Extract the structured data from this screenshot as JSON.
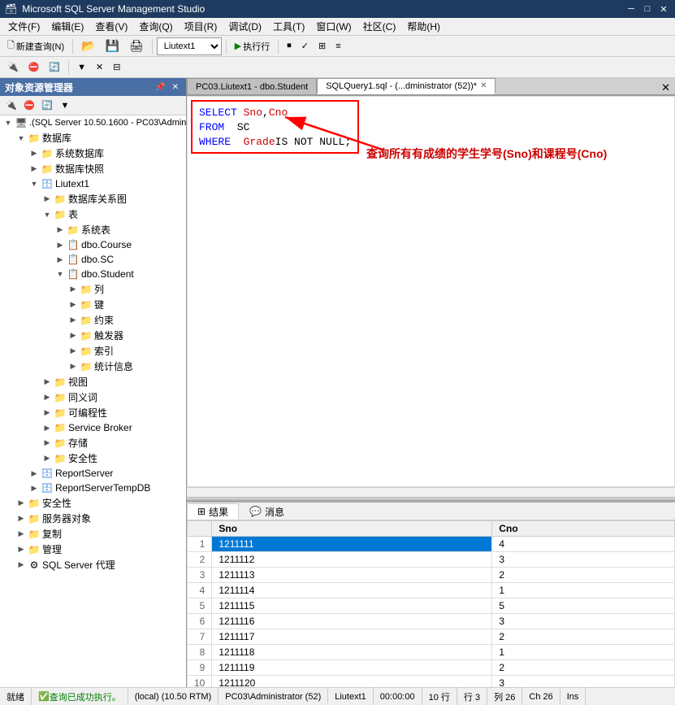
{
  "titleBar": {
    "title": "Microsoft SQL Server Management Studio",
    "icon": "💾",
    "controls": [
      "─",
      "□",
      "✕"
    ]
  },
  "menuBar": {
    "items": [
      "文件(F)",
      "编辑(E)",
      "查看(V)",
      "查询(Q)",
      "项目(R)",
      "调试(D)",
      "工具(T)",
      "窗口(W)",
      "社区(C)",
      "帮助(H)"
    ]
  },
  "toolbar1": {
    "newQuery": "🗋 新建查询(N)",
    "database": "Liutext1",
    "execute": "▶ 执行行"
  },
  "toolbar2": {
    "items": [
      "new",
      "open",
      "save",
      "connect",
      "disconnect",
      "options"
    ]
  },
  "objectExplorer": {
    "title": "对象资源管理器",
    "toolbar": [
      "connect",
      "disconnect",
      "filter",
      "refresh"
    ],
    "tree": [
      {
        "level": 0,
        "expanded": true,
        "icon": "server",
        "label": ".(SQL Server 10.50.1600 - PC03\\Adminis"
      },
      {
        "level": 1,
        "expanded": true,
        "icon": "folder",
        "label": "数据库"
      },
      {
        "level": 2,
        "expanded": true,
        "icon": "folder",
        "label": "系统数据库"
      },
      {
        "level": 2,
        "expanded": false,
        "icon": "folder",
        "label": "数据库快照"
      },
      {
        "level": 2,
        "expanded": true,
        "icon": "db",
        "label": "Liutext1"
      },
      {
        "level": 3,
        "expanded": false,
        "icon": "folder",
        "label": "数据库关系图"
      },
      {
        "level": 3,
        "expanded": true,
        "icon": "folder",
        "label": "表"
      },
      {
        "level": 4,
        "expanded": false,
        "icon": "folder",
        "label": "系统表"
      },
      {
        "level": 4,
        "expanded": false,
        "icon": "table",
        "label": "dbo.Course"
      },
      {
        "level": 4,
        "expanded": false,
        "icon": "table",
        "label": "dbo.SC"
      },
      {
        "level": 4,
        "expanded": true,
        "icon": "table",
        "label": "dbo.Student"
      },
      {
        "level": 5,
        "expanded": false,
        "icon": "folder",
        "label": "列"
      },
      {
        "level": 5,
        "expanded": false,
        "icon": "folder",
        "label": "键"
      },
      {
        "level": 5,
        "expanded": false,
        "icon": "folder",
        "label": "约束"
      },
      {
        "level": 5,
        "expanded": false,
        "icon": "folder",
        "label": "触发器"
      },
      {
        "level": 5,
        "expanded": false,
        "icon": "folder",
        "label": "索引"
      },
      {
        "level": 5,
        "expanded": false,
        "icon": "folder",
        "label": "统计信息"
      },
      {
        "level": 3,
        "expanded": false,
        "icon": "folder",
        "label": "视图"
      },
      {
        "level": 3,
        "expanded": false,
        "icon": "folder",
        "label": "同义词"
      },
      {
        "level": 3,
        "expanded": false,
        "icon": "folder",
        "label": "可编程性"
      },
      {
        "level": 3,
        "expanded": false,
        "icon": "folder",
        "label": "Service Broker"
      },
      {
        "level": 3,
        "expanded": false,
        "icon": "folder",
        "label": "存储"
      },
      {
        "level": 3,
        "expanded": false,
        "icon": "folder",
        "label": "安全性"
      },
      {
        "level": 2,
        "expanded": false,
        "icon": "db",
        "label": "ReportServer"
      },
      {
        "level": 2,
        "expanded": false,
        "icon": "db",
        "label": "ReportServerTempDB"
      },
      {
        "level": 1,
        "expanded": false,
        "icon": "folder",
        "label": "安全性"
      },
      {
        "level": 1,
        "expanded": false,
        "icon": "folder",
        "label": "服务器对象"
      },
      {
        "level": 1,
        "expanded": false,
        "icon": "folder",
        "label": "复制"
      },
      {
        "level": 1,
        "expanded": false,
        "icon": "folder",
        "label": "管理"
      },
      {
        "level": 1,
        "expanded": false,
        "icon": "agent",
        "label": "SQL Server 代理"
      }
    ]
  },
  "tabs": [
    {
      "label": "PC03.Liutext1 - dbo.Student",
      "active": false,
      "closable": false
    },
    {
      "label": "SQLQuery1.sql - (...dministrator (52))*",
      "active": true,
      "closable": true
    }
  ],
  "queryEditor": {
    "lines": [
      {
        "tokens": [
          {
            "type": "keyword",
            "text": "SELECT"
          },
          {
            "type": "space",
            "text": " "
          },
          {
            "type": "column",
            "text": "Sno"
          },
          {
            "type": "text",
            "text": ", "
          },
          {
            "type": "column",
            "text": "Cno"
          }
        ]
      },
      {
        "tokens": [
          {
            "type": "keyword",
            "text": "FROM"
          },
          {
            "type": "space",
            "text": "  "
          },
          {
            "type": "table",
            "text": "SC"
          }
        ]
      },
      {
        "tokens": [
          {
            "type": "keyword",
            "text": "WHERE"
          },
          {
            "type": "space",
            "text": "  "
          },
          {
            "type": "column",
            "text": "Grade"
          },
          {
            "type": "text",
            "text": " IS NOT NULL;"
          }
        ]
      }
    ],
    "annotation": "查询所有有成绩的学生学号(Sno)和课程号(Cno)"
  },
  "resultsTabs": [
    {
      "label": "结果",
      "icon": "grid",
      "active": true
    },
    {
      "label": "消息",
      "icon": "msg",
      "active": false
    }
  ],
  "resultsTable": {
    "columns": [
      "",
      "Sno",
      "Cno"
    ],
    "rows": [
      {
        "num": 1,
        "sno": "1211111",
        "cno": "4",
        "highlight": true
      },
      {
        "num": 2,
        "sno": "1211112",
        "cno": "3"
      },
      {
        "num": 3,
        "sno": "1211113",
        "cno": "2"
      },
      {
        "num": 4,
        "sno": "1211114",
        "cno": "1"
      },
      {
        "num": 5,
        "sno": "1211115",
        "cno": "5"
      },
      {
        "num": 6,
        "sno": "1211116",
        "cno": "3"
      },
      {
        "num": 7,
        "sno": "1211117",
        "cno": "2"
      },
      {
        "num": 8,
        "sno": "1211118",
        "cno": "1"
      },
      {
        "num": 9,
        "sno": "1211119",
        "cno": "2"
      },
      {
        "num": 10,
        "sno": "1211120",
        "cno": "3"
      }
    ]
  },
  "statusBar": {
    "message": "查询已成功执行。",
    "server": "(local) (10.50 RTM)",
    "user": "PC03\\Administrator (52)",
    "db": "Liutext1",
    "time": "00:00:00",
    "rows": "10 行",
    "readyLabel": "就绪",
    "row": "行 3",
    "col": "列 26",
    "ch": "Ch 26",
    "ins": "Ins"
  }
}
